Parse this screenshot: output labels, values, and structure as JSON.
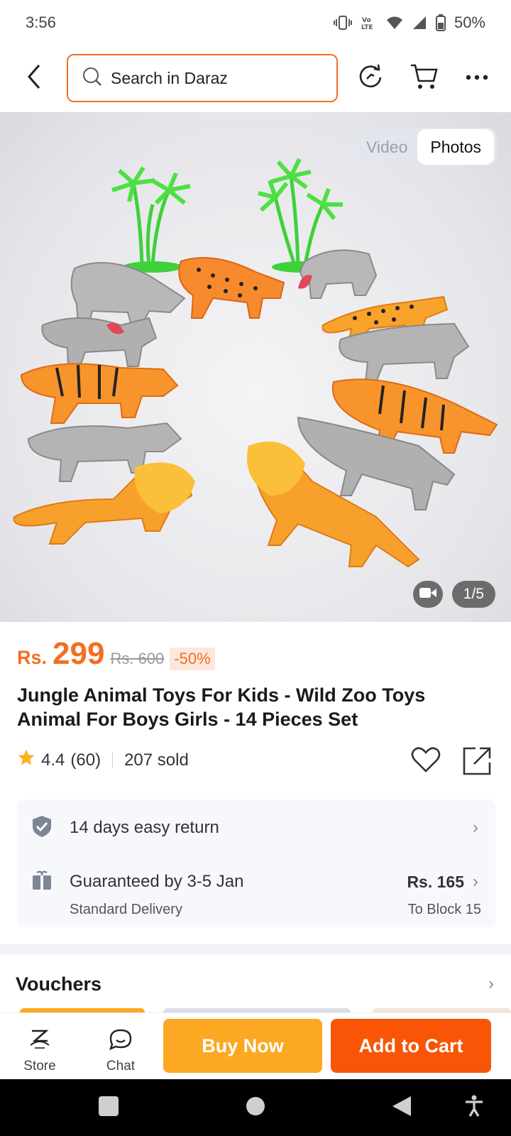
{
  "status_bar": {
    "time": "3:56",
    "battery_percent": "50%",
    "icons": [
      "vibrate-icon",
      "volte-icon",
      "wifi-icon",
      "signal-icon",
      "battery-icon"
    ]
  },
  "header": {
    "search_placeholder": "Search in Daraz",
    "icons": [
      "back-icon",
      "search-icon",
      "refresh-icon",
      "cart-icon",
      "more-icon"
    ]
  },
  "gallery": {
    "tabs": [
      "Video",
      "Photos"
    ],
    "active_tab": "Photos",
    "counter": "1/5",
    "icons": [
      "video-camera-icon"
    ]
  },
  "product": {
    "currency": "Rs.",
    "price": "299",
    "original_price": "Rs. 600",
    "discount": "-50%",
    "title": "Jungle Animal Toys For Kids - Wild Zoo Toys Animal For Boys Girls - 14 Pieces Set",
    "rating": "4.4",
    "reviews": "(60)",
    "sold": "207 sold",
    "rating_stars": 4.4
  },
  "delivery": {
    "return_policy": "14 days easy return",
    "guarantee": "Guaranteed by 3-5 Jan",
    "delivery_type": "Standard Delivery",
    "fee": "Rs. 165",
    "destination": "To Block 15"
  },
  "vouchers": {
    "title": "Vouchers"
  },
  "bottom_bar": {
    "store_label": "Store",
    "chat_label": "Chat",
    "buy_now": "Buy Now",
    "add_to_cart": "Add to Cart"
  },
  "colors": {
    "brand_orange": "#f36f21",
    "buy_now": "#fca822",
    "add_to_cart": "#f85606"
  }
}
